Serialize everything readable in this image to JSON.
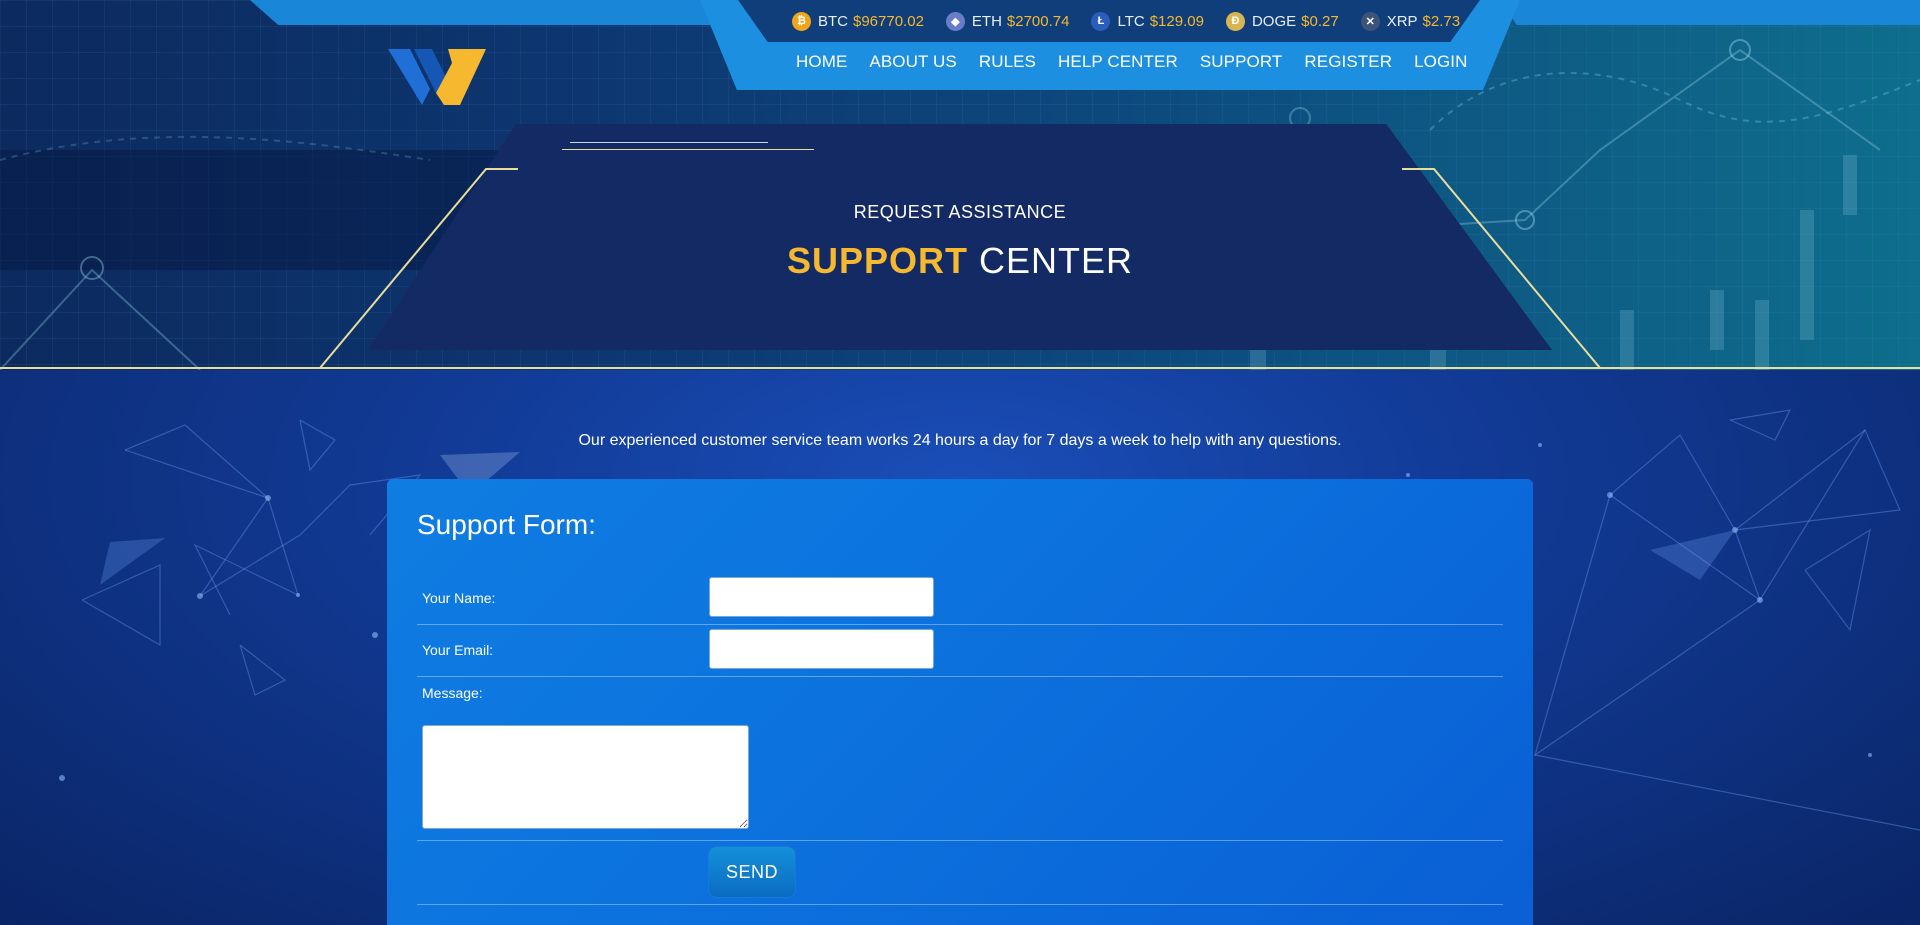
{
  "ticker": [
    {
      "symbol": "BTC",
      "price": "$96770.02",
      "icon": "bitcoin-icon",
      "glyph": "₿",
      "color": "#f0a51a"
    },
    {
      "symbol": "ETH",
      "price": "$2700.74",
      "icon": "ethereum-icon",
      "glyph": "◆",
      "color": "#6a7cc8"
    },
    {
      "symbol": "LTC",
      "price": "$129.09",
      "icon": "litecoin-icon",
      "glyph": "Ł",
      "color": "#2b5dbd"
    },
    {
      "symbol": "DOGE",
      "price": "$0.27",
      "icon": "dogecoin-icon",
      "glyph": "Ð",
      "color": "#d8b552"
    },
    {
      "symbol": "XRP",
      "price": "$2.73",
      "icon": "xrp-icon",
      "glyph": "✕",
      "color": "#3d5378"
    }
  ],
  "nav": [
    "HOME",
    "ABOUT US",
    "RULES",
    "HELP CENTER",
    "SUPPORT",
    "REGISTER",
    "LOGIN"
  ],
  "hero": {
    "subtitle": "REQUEST ASSISTANCE",
    "title_accent": "SUPPORT",
    "title_rest": "CENTER"
  },
  "intro": "Our experienced customer service team works 24 hours a day for 7 days a week to help with any questions.",
  "form": {
    "title": "Support Form:",
    "name_label": "Your Name:",
    "email_label": "Your Email:",
    "message_label": "Message:",
    "name_value": "",
    "email_value": "",
    "message_value": "",
    "send_label": "SEND"
  },
  "colors": {
    "accent": "#f5b82e",
    "nav_bar": "#1c8fe0",
    "form_bg": "#0c73de"
  }
}
